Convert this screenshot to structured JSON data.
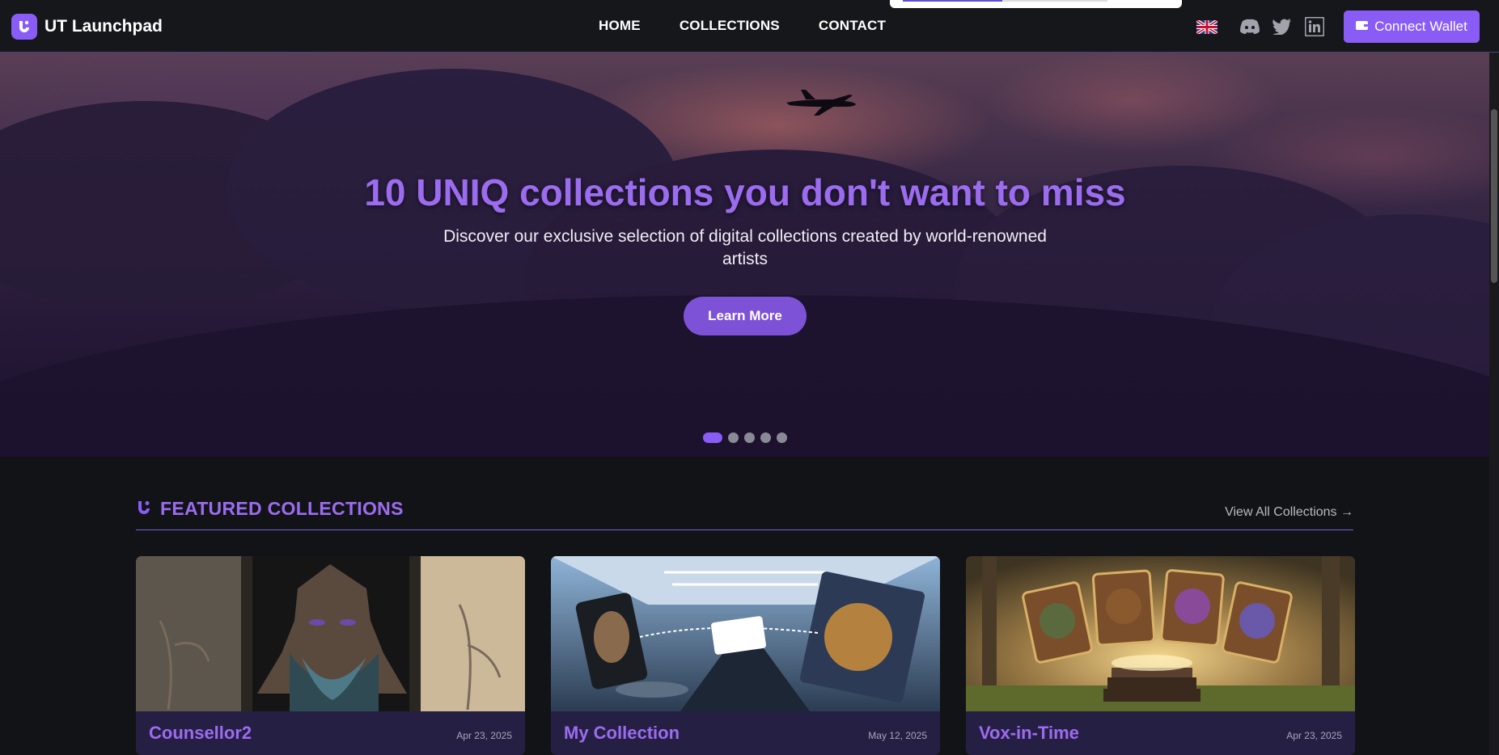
{
  "brand": {
    "name": "UT Launchpad"
  },
  "nav": {
    "links": [
      {
        "label": "HOME"
      },
      {
        "label": "COLLECTIONS"
      },
      {
        "label": "CONTACT"
      }
    ]
  },
  "header_right": {
    "language_icon": "uk-flag-icon",
    "social_icons": [
      "discord-icon",
      "twitter-icon",
      "linkedin-icon"
    ],
    "connect_label": "Connect Wallet"
  },
  "hero": {
    "title": "10 UNIQ collections you don't want to miss",
    "subtitle": "Discover our exclusive selection of digital collections created by world-renowned artists",
    "button_label": "Learn More",
    "slide_count": 5,
    "active_slide": 1
  },
  "featured": {
    "title": "FEATURED COLLECTIONS",
    "view_all": "View All Collections →",
    "cards": [
      {
        "title": "Counsellor2",
        "date": "Apr 23, 2025"
      },
      {
        "title": "My Collection",
        "date": "May 12, 2025"
      },
      {
        "title": "Vox-in-Time",
        "date": "Apr 23, 2025"
      }
    ]
  },
  "colors": {
    "accent": "#8a5cf6",
    "title_purple": "#9c6cf0",
    "background": "#121316",
    "card_footer": "#261f44"
  }
}
